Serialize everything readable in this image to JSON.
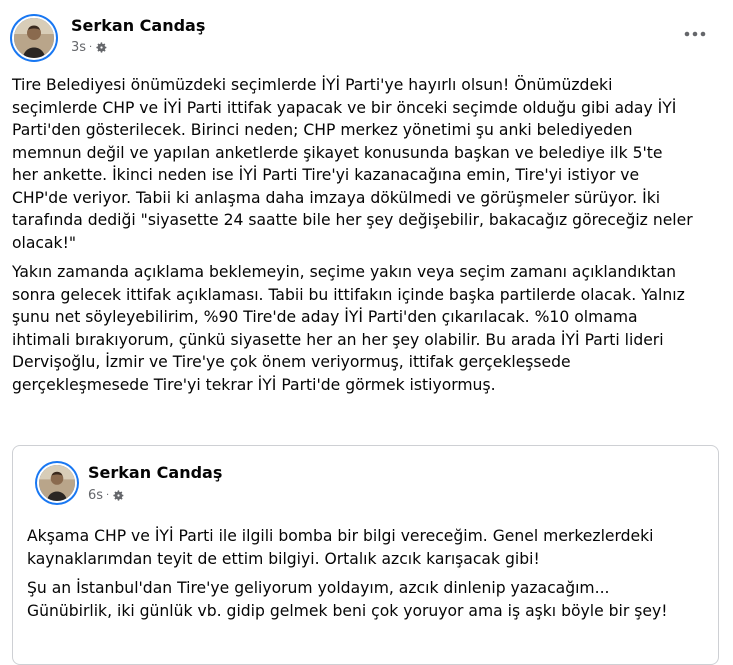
{
  "post": {
    "author": "Serkan Candaş",
    "time": "3s",
    "more_icon": "more-horizontal-icon",
    "privacy_icon": "gear-icon",
    "paragraphs": [
      "Tire Belediyesi önümüzdeki seçimlerde İYİ Parti'ye hayırlı olsun! Önümüzdeki\nseçimlerde CHP ve İYİ Parti ittifak yapacak ve bir önceki seçimde olduğu gibi aday İYİ\nParti'den gösterilecek. Birinci neden; CHP merkez yönetimi şu anki belediyeden\nmemnun değil ve yapılan anketlerde şikayet konusunda başkan ve belediye ilk 5'te\nher ankette. İkinci neden ise İYİ Parti Tire'yi kazanacağına emin, Tire'yi istiyor ve\nCHP'de veriyor. Tabii ki anlaşma daha imzaya dökülmedi ve görüşmeler sürüyor. İki\ntarafında dediği \"siyasette 24 saatte bile her şey değişebilir, bakacağız göreceğiz neler\nolacak!\"",
      "Yakın zamanda açıklama beklemeyin, seçime yakın veya seçim zamanı açıklandıktan\nsonra gelecek ittifak açıklaması. Tabii bu ittifakın içinde başka partilerde olacak. Yalnız\nşunu net söyleyebilirim, %90 Tire'de aday İYİ Parti'den çıkarılacak. %10 olmama\nihtimali bırakıyorum, çünkü siyasette her an her şey olabilir. Bu arada İYİ Parti lideri\nDervişoğlu, İzmir ve Tire'ye çok önem veriyormuş, ittifak gerçekleşsede\ngerçekleşmesede Tire'yi tekrar İYİ Parti'de görmek istiyormuş."
    ]
  },
  "shared_post": {
    "author": "Serkan Candaş",
    "time": "6s",
    "privacy_icon": "gear-icon",
    "paragraphs": [
      "Akşama CHP ve İYİ Parti ile ilgili bomba bir bilgi vereceğim. Genel merkezlerdeki\nkaynaklarımdan teyit de ettim bilgiyi. Ortalık azcık karışacak gibi!",
      "Şu an İstanbul'dan Tire'ye geliyorum yoldayım, azcık dinlenip yazacağım...\nGünübirlik, iki günlük vb. gidip gelmek beni çok yoruyor ama iş aşkı böyle bir şey!"
    ]
  },
  "colors": {
    "text": "#050505",
    "secondary_text": "#65676b",
    "avatar_ring": "#1877f2",
    "card_border": "#ced0d4"
  },
  "separator": "·"
}
